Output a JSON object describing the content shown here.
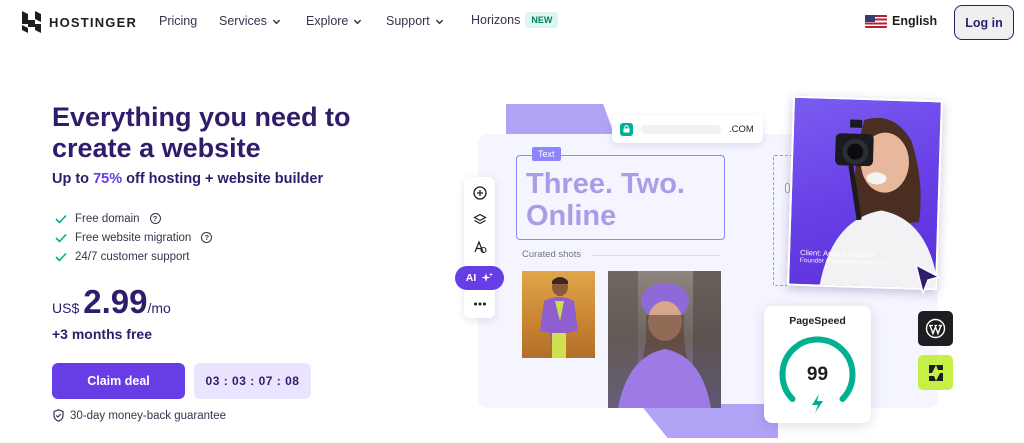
{
  "nav": {
    "brand": "HOSTINGER",
    "items": [
      {
        "label": "Pricing",
        "has_dropdown": false
      },
      {
        "label": "Services",
        "has_dropdown": true
      },
      {
        "label": "Explore",
        "has_dropdown": true
      },
      {
        "label": "Support",
        "has_dropdown": true
      },
      {
        "label": "Horizons",
        "has_dropdown": false,
        "badge": "NEW"
      }
    ],
    "language": "English",
    "login_label": "Log in"
  },
  "hero": {
    "title": "Everything you need to create a website",
    "subtitle_prefix": "Up to ",
    "subtitle_highlight": "75%",
    "subtitle_suffix": " off hosting + website builder",
    "features": [
      {
        "label": "Free domain",
        "info": true
      },
      {
        "label": "Free website migration",
        "info": true
      },
      {
        "label": "24/7 customer support",
        "info": false
      }
    ],
    "price": {
      "currency": "US$",
      "amount": "2.99",
      "period": "/mo"
    },
    "bonus": "+3 months free",
    "cta_label": "Claim deal",
    "countdown": "03 : 03 : 07 : 08",
    "guarantee": "30-day money-back guarantee"
  },
  "illustration": {
    "domain_suffix": ".COM",
    "text_tag": "Text",
    "headline": "Three. Two. Online",
    "curated_label": "Curated shots",
    "ai_label": "AI",
    "photo_credit_name": "Client: Anna Franques",
    "photo_credit_sub": "Founder of annafranques.com",
    "pagespeed_label": "PageSpeed",
    "pagespeed_score": "99"
  },
  "colors": {
    "brand_dark": "#2f1c6a",
    "accent": "#673de6",
    "accent_light": "#ebe4ff",
    "check_green": "#00b090",
    "horizons_lime": "#c6f046"
  }
}
